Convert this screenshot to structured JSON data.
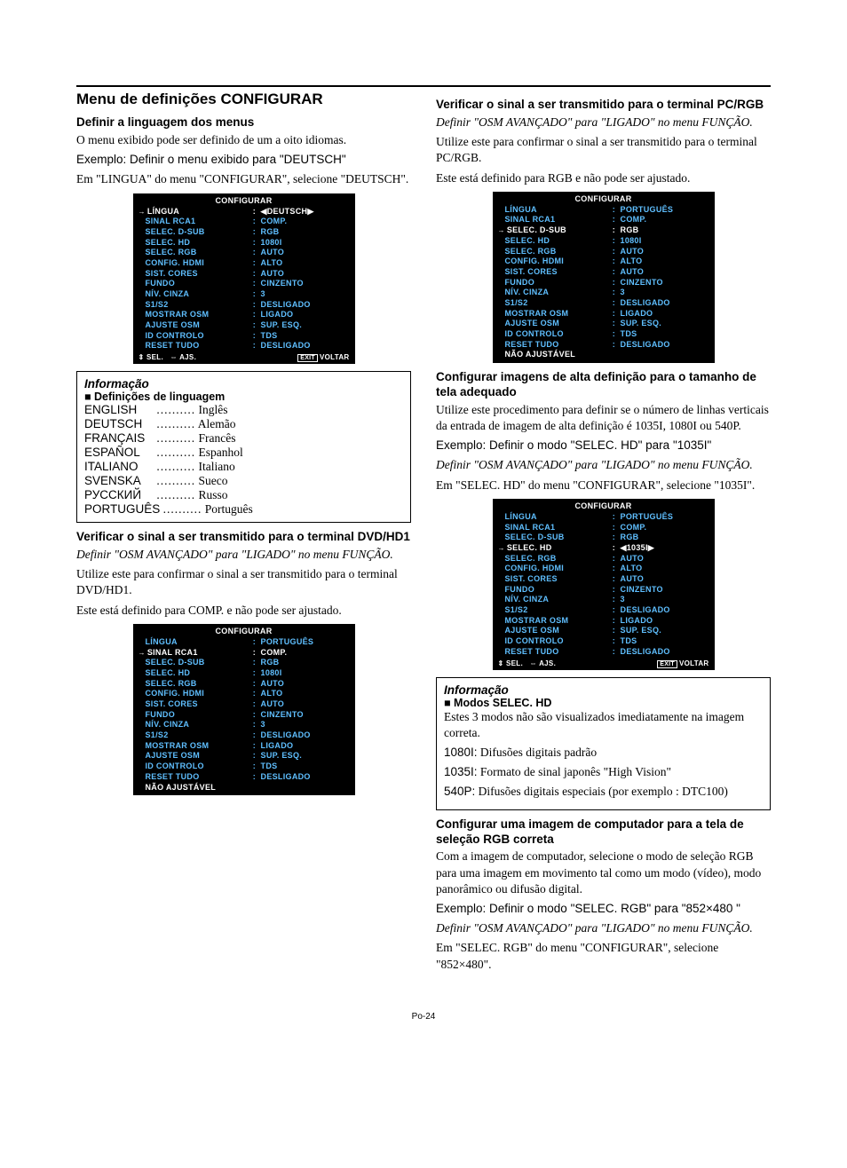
{
  "page_number": "Po-24",
  "left": {
    "h1": "Menu de definições CONFIGURAR",
    "sec1": {
      "title": "Definir a linguagem dos menus",
      "p1": "O menu exibido pode ser definido de um a oito idiomas.",
      "p2": "Exemplo: Definir o menu exibido para \"DEUTSCH\"",
      "p3": "Em \"LINGUA\" do menu \"CONFIGURAR\", selecione \"DEUTSCH\"."
    },
    "osd1": {
      "head": "CONFIGURAR",
      "rows": [
        {
          "l": "LÍNGUA",
          "v": "◀DEUTSCH▶",
          "sel": true,
          "arrow": true,
          "lbr": true
        },
        {
          "l": "SINAL RCA1",
          "v": "COMP."
        },
        {
          "l": "SELEC. D-SUB",
          "v": "RGB"
        },
        {
          "l": "SELEC. HD",
          "v": "1080I"
        },
        {
          "l": "SELEC. RGB",
          "v": "AUTO"
        },
        {
          "l": "CONFIG. HDMI",
          "v": "ALTO"
        },
        {
          "l": "SIST. CORES",
          "v": "AUTO"
        },
        {
          "l": "FUNDO",
          "v": "CINZENTO"
        },
        {
          "l": "NÍV. CINZA",
          "v": "3"
        },
        {
          "l": "S1/S2",
          "v": "DESLIGADO"
        },
        {
          "l": "MOSTRAR OSM",
          "v": "LIGADO"
        },
        {
          "l": "AJUSTE OSM",
          "v": "SUP. ESQ."
        },
        {
          "l": "ID CONTROLO",
          "v": "TDS"
        },
        {
          "l": "RESET TUDO",
          "v": "DESLIGADO"
        }
      ],
      "foot_sel": "SEL.",
      "foot_ajs": "AJS.",
      "foot_exit": "EXIT",
      "foot_voltar": "VOLTAR"
    },
    "info1": {
      "h": "Informação",
      "sub": "Definições de linguagem",
      "langs": [
        {
          "a": "ENGLISH",
          "b": "Inglês"
        },
        {
          "a": "DEUTSCH",
          "b": "Alemão"
        },
        {
          "a": "FRANÇAIS",
          "b": "Francês"
        },
        {
          "a": "ESPAÑOL",
          "b": "Espanhol"
        },
        {
          "a": "ITALIANO",
          "b": "Italiano"
        },
        {
          "a": "SVENSKA",
          "b": "Sueco"
        },
        {
          "a": "РУССКИЙ",
          "b": "Russo"
        },
        {
          "a": "PORTUGUÊS",
          "b": "Português"
        }
      ]
    },
    "sec2": {
      "title": "Verificar o sinal a ser transmitido para o terminal DVD/HD1",
      "p1": "Definir \"OSM AVANÇADO\" para \"LIGADO\" no menu FUNÇÃO.",
      "p2": "Utilize este para confirmar o sinal a ser transmitido para o terminal DVD/HD1.",
      "p3": "Este está definido para COMP. e não pode ser ajustado."
    },
    "osd2": {
      "head": "CONFIGURAR",
      "rows": [
        {
          "l": "LÍNGUA",
          "v": "PORTUGUÊS"
        },
        {
          "l": "SINAL RCA1",
          "v": "COMP.",
          "sel": true,
          "arrow": true
        },
        {
          "l": "SELEC. D-SUB",
          "v": "RGB"
        },
        {
          "l": "SELEC. HD",
          "v": "1080I"
        },
        {
          "l": "SELEC. RGB",
          "v": "AUTO"
        },
        {
          "l": "CONFIG. HDMI",
          "v": "ALTO"
        },
        {
          "l": "SIST. CORES",
          "v": "AUTO"
        },
        {
          "l": "FUNDO",
          "v": "CINZENTO"
        },
        {
          "l": "NÍV. CINZA",
          "v": "3"
        },
        {
          "l": "S1/S2",
          "v": "DESLIGADO"
        },
        {
          "l": "MOSTRAR OSM",
          "v": "LIGADO"
        },
        {
          "l": "AJUSTE OSM",
          "v": "SUP. ESQ."
        },
        {
          "l": "ID CONTROLO",
          "v": "TDS"
        },
        {
          "l": "RESET TUDO",
          "v": "DESLIGADO"
        }
      ],
      "note": "NÃO AJUSTÁVEL"
    }
  },
  "right": {
    "sec3": {
      "title": "Verificar o sinal a ser transmitido para o terminal PC/RGB",
      "p1": "Definir \"OSM AVANÇADO\" para \"LIGADO\" no menu FUNÇÃO.",
      "p2": "Utilize este para confirmar o sinal a ser transmitido para o terminal PC/RGB.",
      "p3": "Este está definido para RGB e não pode ser ajustado."
    },
    "osd3": {
      "head": "CONFIGURAR",
      "rows": [
        {
          "l": "LÍNGUA",
          "v": "PORTUGUÊS"
        },
        {
          "l": "SINAL RCA1",
          "v": "COMP."
        },
        {
          "l": "SELEC. D-SUB",
          "v": "RGB",
          "sel": true,
          "arrow": true
        },
        {
          "l": "SELEC. HD",
          "v": "1080I"
        },
        {
          "l": "SELEC. RGB",
          "v": "AUTO"
        },
        {
          "l": "CONFIG. HDMI",
          "v": "ALTO"
        },
        {
          "l": "SIST. CORES",
          "v": "AUTO"
        },
        {
          "l": "FUNDO",
          "v": "CINZENTO"
        },
        {
          "l": "NÍV. CINZA",
          "v": "3"
        },
        {
          "l": "S1/S2",
          "v": "DESLIGADO"
        },
        {
          "l": "MOSTRAR OSM",
          "v": "LIGADO"
        },
        {
          "l": "AJUSTE OSM",
          "v": "SUP. ESQ."
        },
        {
          "l": "ID CONTROLO",
          "v": "TDS"
        },
        {
          "l": "RESET TUDO",
          "v": "DESLIGADO"
        }
      ],
      "note": "NÃO AJUSTÁVEL"
    },
    "sec4": {
      "title": "Configurar imagens de alta definição para o tamanho de tela adequado",
      "p1": "Utilize este procedimento para definir se o número de linhas verticais da entrada de imagem de alta definição é 1035I, 1080I ou 540P.",
      "p2": "Exemplo: Definir o modo \"SELEC. HD\" para \"1035I\"",
      "p3": "Definir \"OSM AVANÇADO\" para \"LIGADO\" no menu FUNÇÃO.",
      "p4": "Em \"SELEC. HD\" do menu \"CONFIGURAR\", selecione \"1035I\"."
    },
    "osd4": {
      "head": "CONFIGURAR",
      "rows": [
        {
          "l": "LÍNGUA",
          "v": "PORTUGUÊS"
        },
        {
          "l": "SINAL RCA1",
          "v": "COMP."
        },
        {
          "l": "SELEC. D-SUB",
          "v": "RGB"
        },
        {
          "l": "SELEC. HD",
          "v": "◀1035I▶",
          "sel": true,
          "arrow": true,
          "lbr": true
        },
        {
          "l": "SELEC. RGB",
          "v": "AUTO"
        },
        {
          "l": "CONFIG. HDMI",
          "v": "ALTO"
        },
        {
          "l": "SIST. CORES",
          "v": "AUTO"
        },
        {
          "l": "FUNDO",
          "v": "CINZENTO"
        },
        {
          "l": "NÍV. CINZA",
          "v": "3"
        },
        {
          "l": "S1/S2",
          "v": "DESLIGADO"
        },
        {
          "l": "MOSTRAR OSM",
          "v": "LIGADO"
        },
        {
          "l": "AJUSTE OSM",
          "v": "SUP. ESQ."
        },
        {
          "l": "ID CONTROLO",
          "v": "TDS"
        },
        {
          "l": "RESET TUDO",
          "v": "DESLIGADO"
        }
      ],
      "foot_sel": "SEL.",
      "foot_ajs": "AJS.",
      "foot_exit": "EXIT",
      "foot_voltar": "VOLTAR"
    },
    "info2": {
      "h": "Informação",
      "sub": "Modos SELEC. HD",
      "p1": "Estes 3 modos não são visualizados imediatamente na imagem correta.",
      "l1a": "1080I:",
      "l1b": " Difusões digitais padrão",
      "l2a": "1035I:",
      "l2b": " Formato de sinal japonês \"High Vision\"",
      "l3a": "540P:",
      "l3b": " Difusões digitais especiais (por exemplo : DTC100)"
    },
    "sec5": {
      "title": "Configurar uma imagem de computador para a tela de seleção RGB correta",
      "p1": "Com a imagem de computador, selecione o modo de seleção RGB para uma imagem em movimento tal como um modo (vídeo), modo panorâmico ou difusão digital.",
      "p2": "Exemplo: Definir o modo \"SELEC. RGB\" para \"852×480 \"",
      "p3": "Definir \"OSM AVANÇADO\" para \"LIGADO\" no menu FUNÇÃO.",
      "p4": "Em \"SELEC. RGB\" do menu \"CONFIGURAR\", selecione \"852×480\"."
    }
  }
}
